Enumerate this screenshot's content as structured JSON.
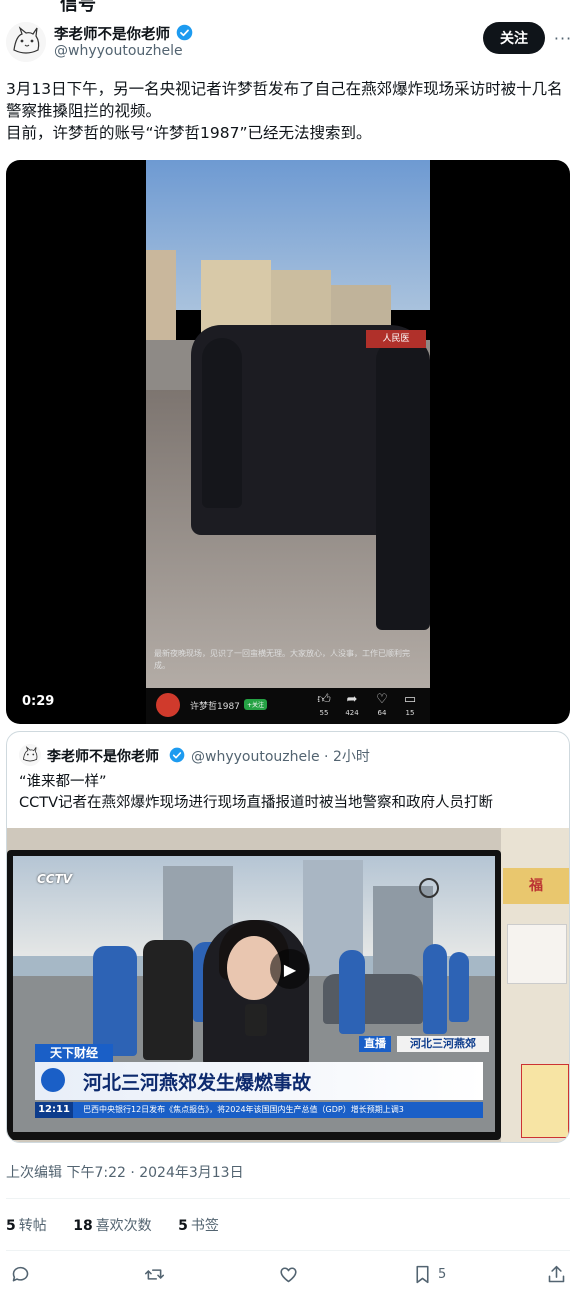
{
  "top_cut_text": "信号",
  "author": {
    "name": "李老师不是你老师",
    "handle": "@whyyoutouzhele",
    "follow_label": "关注",
    "more_label": "···"
  },
  "tweet": {
    "line1": "3月13日下午，另一名央视记者许梦哲发布了自己在燕郊爆炸现场采访时被十几名警察推搡阻拦的视频。",
    "line2": "目前，许梦哲的账号“许梦哲1987”已经无法搜索到。"
  },
  "video": {
    "duration": "0:29",
    "sign_text": "人民医",
    "caption": "最新夜晚现场，见识了一回蛮横无理。大家放心，人没事，工作已顺利完成。",
    "uploader": "许梦哲1987",
    "uploader_follow": "+关注",
    "stats": {
      "likes": "55",
      "shares": "424",
      "favs": "64",
      "comments": "15"
    }
  },
  "quote": {
    "name": "李老师不是你老师",
    "handle_time": "@whyyoutouzhele · 2小时",
    "line1": "“谁来都一样”",
    "line2": "CCTV记者在燕郊爆炸现场进行现场直播报道时被当地警察和政府人员打断",
    "tv": {
      "logo": "CCTV",
      "live": "直播",
      "location": "河北三河燕郊",
      "program": "天下财经",
      "headline": "河北三河燕郊发生爆燃事故",
      "ticker_time": "12:11",
      "ticker": "巴西中央银行12日发布《焦点报告》，将2024年该国国内生产总值（GDP）增长预期上调3",
      "poster": "福"
    }
  },
  "edit_line": "上次编辑 下午7:22 · 2024年3月13日",
  "stats": {
    "reposts_num": "5",
    "reposts_label": "转帖",
    "likes_num": "18",
    "likes_label": "喜欢次数",
    "bookmarks_num": "5",
    "bookmarks_label": "书签"
  },
  "actions": {
    "bookmark_count": "5"
  },
  "colors": {
    "accent": "#1d9bf0",
    "text": "#0f1419",
    "muted": "#536471",
    "border": "#cfd9de"
  }
}
